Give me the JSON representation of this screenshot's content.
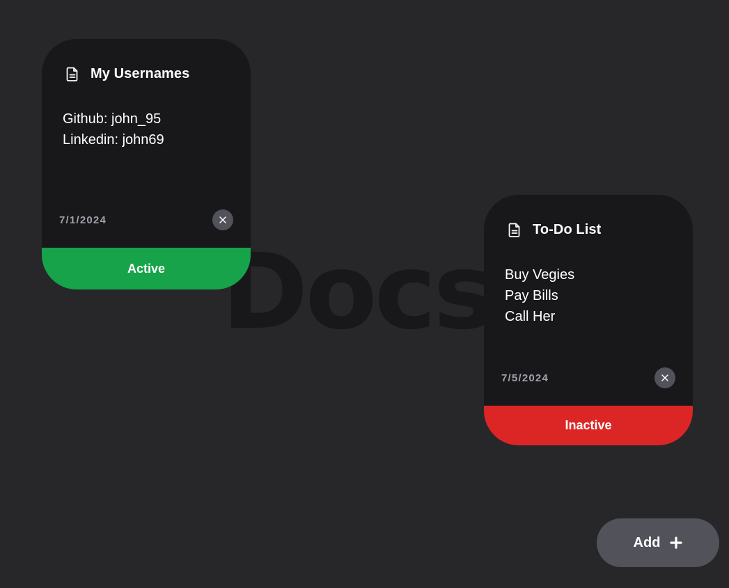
{
  "background_title": "Docs",
  "colors": {
    "background": "#27272a",
    "card": "#18181b",
    "active": "#16a34a",
    "inactive": "#dc2626",
    "button": "#52525b"
  },
  "cards": [
    {
      "icon": "document-icon",
      "title": "My Usernames",
      "lines": [
        "Github: john_95",
        "Linkedin: john69"
      ],
      "date": "7/1/2024",
      "close_icon": "close-icon",
      "status": "Active"
    },
    {
      "icon": "document-icon",
      "title": "To-Do List",
      "lines": [
        "Buy Vegies",
        "Pay Bills",
        "Call Her"
      ],
      "date": "7/5/2024",
      "close_icon": "close-icon",
      "status": "Inactive"
    }
  ],
  "add_button": {
    "label": "Add",
    "icon": "plus-icon"
  }
}
